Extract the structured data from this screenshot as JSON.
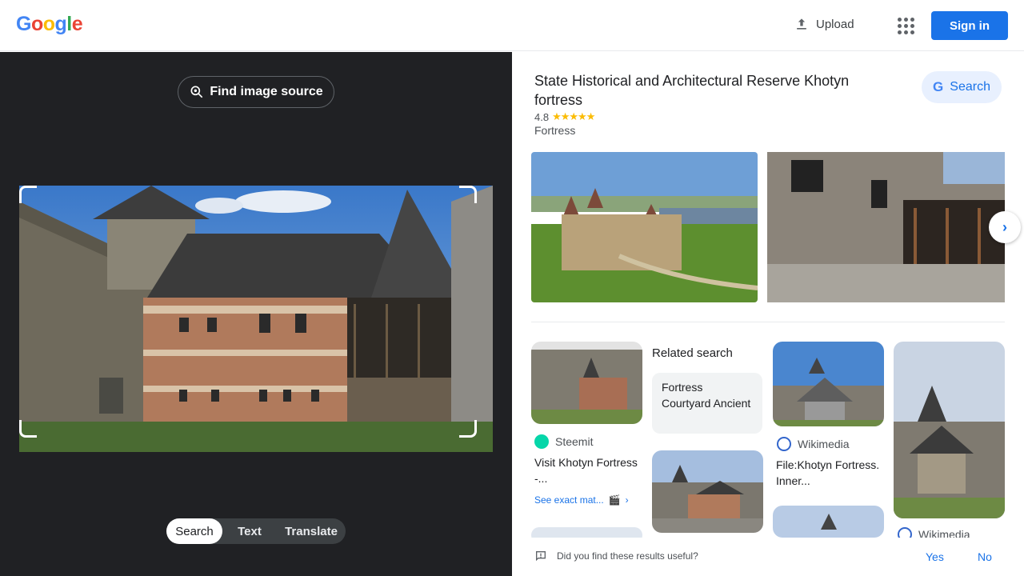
{
  "header": {
    "logo_letters": [
      {
        "ch": "G",
        "color": "#4285f4"
      },
      {
        "ch": "o",
        "color": "#ea4335"
      },
      {
        "ch": "o",
        "color": "#fbbc05"
      },
      {
        "ch": "g",
        "color": "#4285f4"
      },
      {
        "ch": "l",
        "color": "#34a853"
      },
      {
        "ch": "e",
        "color": "#ea4335"
      }
    ],
    "upload_label": "Upload",
    "apps_icon": "apps-grid-icon",
    "signin_label": "Sign in"
  },
  "left": {
    "find_source_label": "Find image source",
    "modes": [
      {
        "label": "Search",
        "active": true
      },
      {
        "label": "Text",
        "active": false
      },
      {
        "label": "Translate",
        "active": false
      }
    ]
  },
  "knowledge_panel": {
    "title": "State Historical and Architectural Reserve Khotyn fortress",
    "rating": "4.8",
    "stars": "★★★★★",
    "type": "Fortress",
    "search_label": "Search"
  },
  "results": {
    "col1": {
      "source": "Steemit",
      "title": "Visit Khotyn Fortress -...",
      "exact_label": "See exact mat..."
    },
    "related": {
      "heading": "Related search",
      "terms": "Fortress Courtyard Ancient"
    },
    "col3": {
      "source": "Wikimedia",
      "title": "File:Khotyn Fortress. Inner..."
    },
    "col4": {
      "source": "Wikimedia"
    }
  },
  "feedback": {
    "question": "Did you find these results useful?",
    "yes": "Yes",
    "no": "No"
  },
  "colors": {
    "accent": "#1a73e8",
    "dark_panel": "#202124",
    "star": "#fbbc04"
  }
}
